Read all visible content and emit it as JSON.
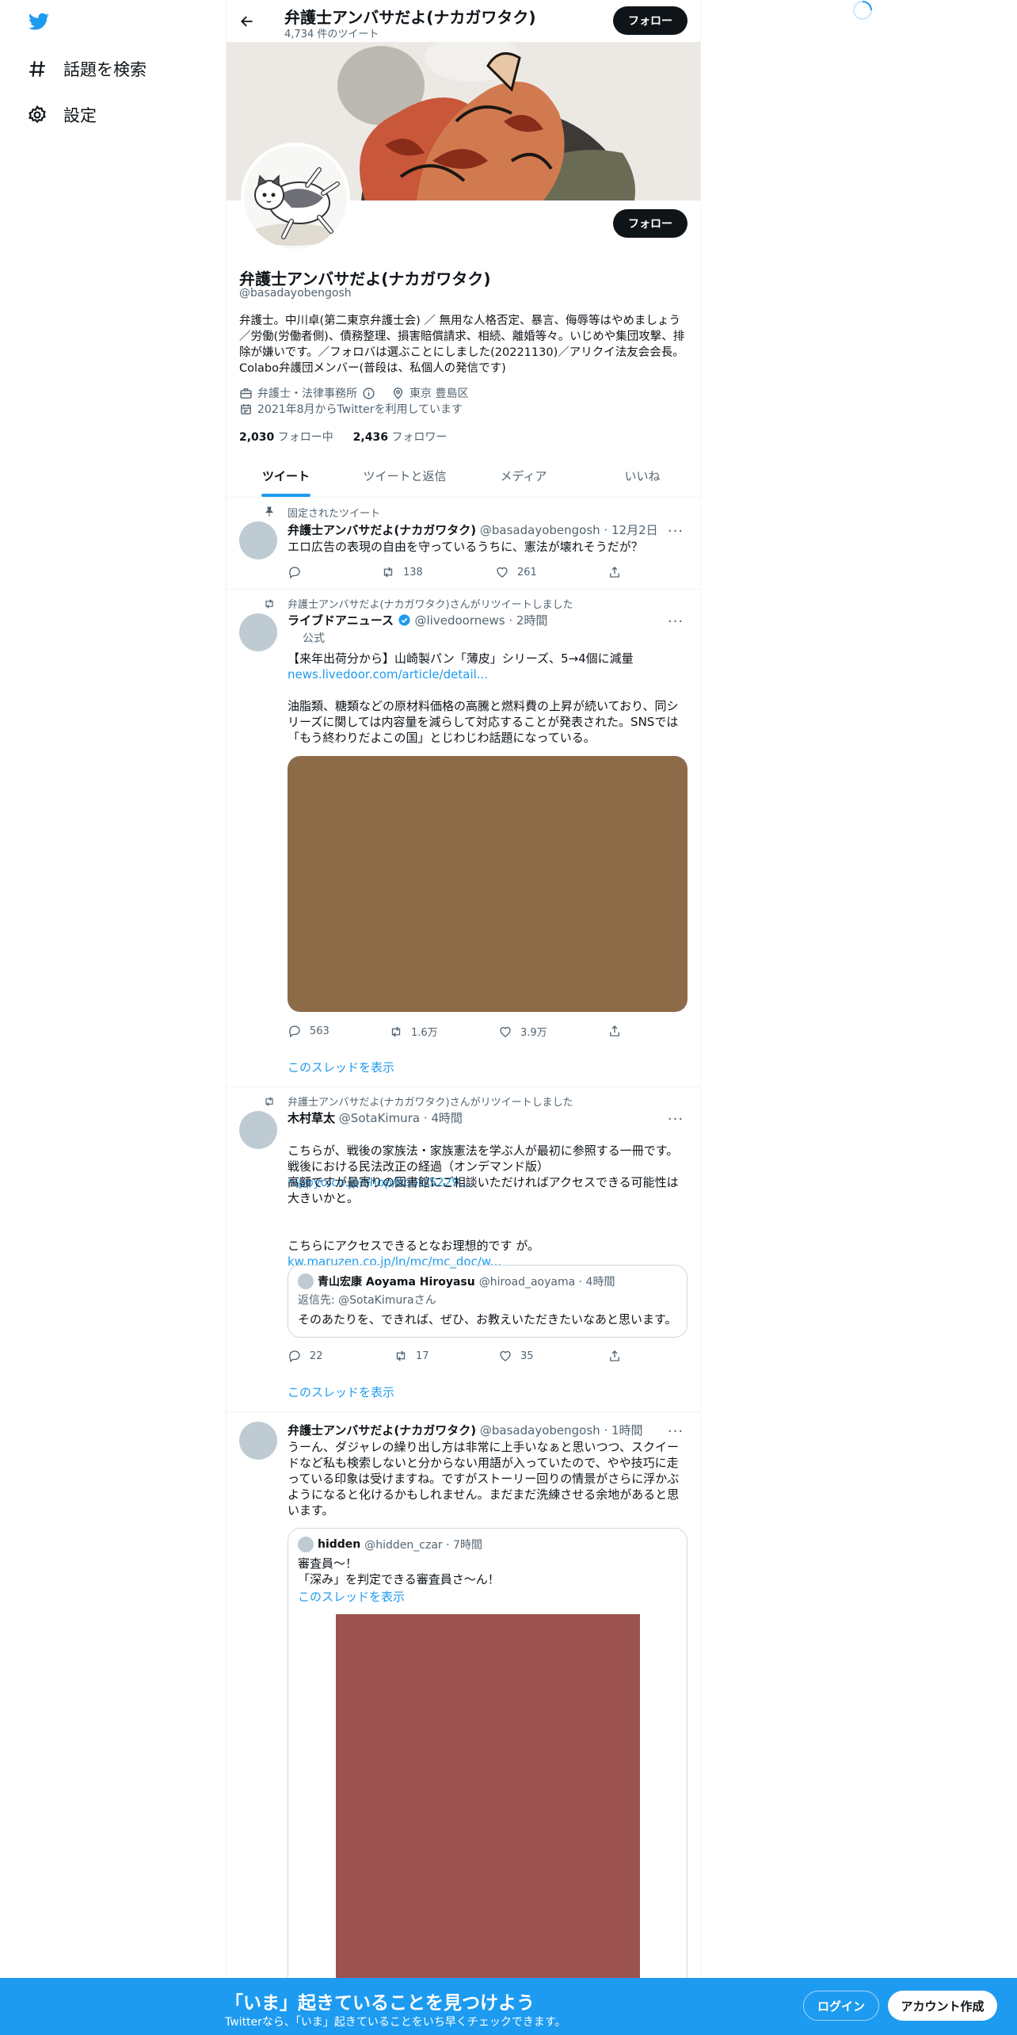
{
  "nav": {
    "explore": "話題を検索",
    "settings": "設定"
  },
  "header": {
    "title": "弁護士アンバサだよ(ナカガワタク)",
    "tweet_count": "4,734 件のツイート",
    "follow": "フォロー"
  },
  "profile": {
    "name": "弁護士アンバサだよ(ナカガワタク)",
    "handle": "@basadayobengosh",
    "bio": "弁護士。中川卓(第二東京弁護士会) ／ 無用な人格否定、暴言、侮辱等はやめましょう／労働(労働者側)、債務整理、損害賠償請求、相続、離婚等々。いじめや集団攻撃、排除が嫌いです。／フォロバは選ぶことにしました(20221130)／アリクイ法友会会長。Colabo弁護団メンバー(普段は、私個人の発信です)",
    "category": "弁護士・法律事務所",
    "location": "東京 豊島区",
    "joined": "2021年8月からTwitterを利用しています",
    "following_count": "2,030",
    "following_label": "フォロー中",
    "followers_count": "2,436",
    "followers_label": "フォロワー",
    "follow": "フォロー"
  },
  "tabs": [
    "ツイート",
    "ツイートと返信",
    "メディア",
    "いいね"
  ],
  "tweets": [
    {
      "context": "固定されたツイート",
      "name": "弁護士アンバサだよ(ナカガワタク)",
      "meta": "@basadayobengosh · 12月2日",
      "text": "エロ広告の表現の自由を守っているうちに、憲法が壊れそうだが？",
      "replies": "",
      "retweets": "138",
      "likes": "261"
    },
    {
      "context": "弁護士アンバサだよ(ナカガワタク)さんがリツイートしました",
      "name": "ライブドアニュース",
      "meta": "@livedoornews · 2時間",
      "badge": "公式",
      "text": "【来年出荷分から】山崎製パン「薄皮」シリーズ、5→4個に減量",
      "link": "news.livedoor.com/article/detail...",
      "text2": "油脂類、糖類などの原材料価格の高騰と燃料費の上昇が続いており、同シリーズに関しては内容量を減らして対応することが発表された。SNSでは「もう終わりだよこの国」とじわじわ話題になっている。",
      "media_color": "#8d6b49",
      "replies": "563",
      "retweets": "1.6万",
      "likes": "3.9万",
      "show_thread": "このスレッドを表示"
    },
    {
      "context": "弁護士アンバサだよ(ナカガワタク)さんがリツイートしました",
      "name": "木村草太",
      "meta": "@SotaKimura · 4時間",
      "text_a": "こちらが、戦後の家族法・家族憲法を学ぶ人が最初に参照する一冊です。戦後における民法改正の経過（オンデマンド版）",
      "link_a": "nippyo.co.jp/shop/book/5229...",
      "text_b": "高額ですが最寄りの図書館にご相談いただければアクセスできる可能性は大きいかと。",
      "text_c": "こちらにアクセスできるとなお理想的です が。",
      "link_c": "kw.maruzen.co.jp/ln/mc/mc_doc/w...",
      "quote_name": "青山宏康 Aoyama Hiroyasu",
      "quote_meta": "@hiroad_aoyama · 4時間",
      "quote_reply": "返信先: @SotaKimuraさん",
      "quote_text": "そのあたりを、できれば、ぜひ、お教えいただきたいなあと思います。",
      "replies": "22",
      "retweets": "17",
      "likes": "35",
      "show_thread": "このスレッドを表示"
    },
    {
      "name": "弁護士アンバサだよ(ナカガワタク)",
      "meta": "@basadayobengosh · 1時間",
      "text": "うーん、ダジャレの繰り出し方は非常に上手いなぁと思いつつ、スクイードなど私も検索しないと分からない用語が入っていたので、やや技巧に走っている印象は受けますね。ですがストーリー回りの情景がさらに浮かぶようになると化けるかもしれません。まだまだ洗練させる余地があると思います。",
      "quote_name": "hidden",
      "quote_meta": "@hidden_czar · 7時間",
      "quote_text": "審査員〜！\n「深み」を判定できる審査員さ〜ん！",
      "quote_show_thread": "このスレッドを表示",
      "media_color": "#9c5350"
    }
  ],
  "bottom": {
    "title": "「いま」起きていることを見つけよう",
    "sub": "Twitterなら、「いま」起きていることをいち早くチェックできます。",
    "login": "ログイン",
    "signup": "アカウント作成"
  },
  "colors": {
    "accent": "#1d9bf0",
    "text": "#0f1419",
    "muted": "#536471"
  }
}
